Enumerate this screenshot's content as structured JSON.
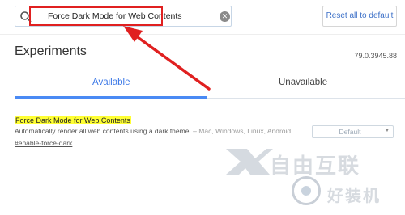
{
  "search": {
    "value": "Force Dark Mode for Web Contents",
    "clear_icon": "clear-circle-icon"
  },
  "header": {
    "reset_label": "Reset all to default",
    "title": "Experiments",
    "version": "79.0.3945.88"
  },
  "tabs": [
    {
      "label": "Available",
      "active": true
    },
    {
      "label": "Unavailable",
      "active": false
    }
  ],
  "experiment": {
    "title": "Force Dark Mode for Web Contents",
    "description": "Automatically render all web contents using a dark theme.",
    "platforms": " – Mac, Windows, Linux, Android",
    "link": "#enable-force-dark",
    "selected_option": "Default"
  },
  "watermark": {
    "main": "自由互联",
    "sub": "好装机"
  },
  "colors": {
    "accent": "#4a8af4",
    "highlight": "#ffff33",
    "annotation_red": "#e02020"
  }
}
